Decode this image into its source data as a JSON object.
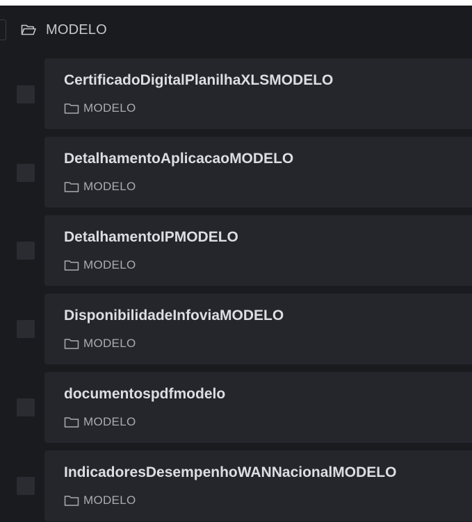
{
  "folder": {
    "label": "MODELO",
    "icon": "folder-open-icon"
  },
  "items": [
    {
      "title": "CertificadoDigitalPlanilhaXLSMODELO",
      "folder": "MODELO",
      "icon": "folder-icon"
    },
    {
      "title": "DetalhamentoAplicacaoMODELO",
      "folder": "MODELO",
      "icon": "folder-icon"
    },
    {
      "title": "DetalhamentoIPMODELO",
      "folder": "MODELO",
      "icon": "folder-icon"
    },
    {
      "title": "DisponibilidadeInfoviaMODELO",
      "folder": "MODELO",
      "icon": "folder-icon"
    },
    {
      "title": "documentospdfmodelo",
      "folder": "MODELO",
      "icon": "folder-icon"
    },
    {
      "title": "IndicadoresDesempenhoWANNacionalMODELO",
      "folder": "MODELO",
      "icon": "folder-icon"
    }
  ],
  "colors": {
    "background": "#1a1b1f",
    "card": "#25262b",
    "title": "#dcdee2",
    "muted": "#a9acb2"
  }
}
